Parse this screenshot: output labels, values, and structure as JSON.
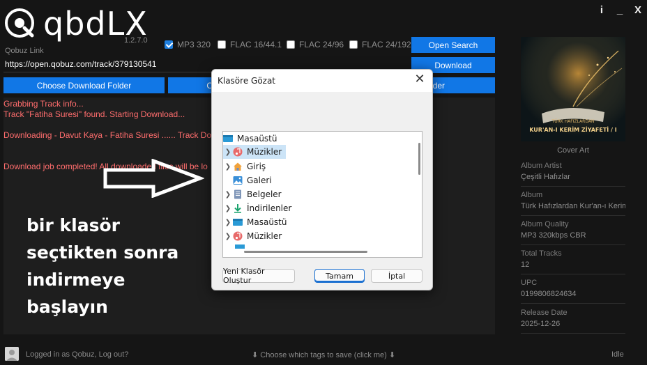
{
  "app": {
    "name": "qbdLX",
    "version": "1.2.7.0",
    "window_controls": [
      "i",
      "_",
      "X"
    ]
  },
  "link": {
    "label": "Qobuz Link",
    "value": "https://open.qobuz.com/track/379130541"
  },
  "formats": [
    {
      "label": "MP3 320",
      "checked": true
    },
    {
      "label": "FLAC 16/44.1",
      "checked": false
    },
    {
      "label": "FLAC 24/96",
      "checked": false
    },
    {
      "label": "FLAC 24/192",
      "checked": false
    }
  ],
  "buttons": {
    "open_search": "Open Search",
    "download": "Download",
    "choose_folder": "Choose Download Folder",
    "open_folder_partial": "O",
    "right_partial": "lder"
  },
  "log": [
    "Grabbing Track info...",
    "Track \"Fatiha Suresi\" found. Starting Download...",
    "Downloading - Davut Kaya - Fatiha Suresi ...... Track Do",
    "Download job completed! All downloaded files will be lo"
  ],
  "overlay": {
    "lines": [
      "bir klasör",
      "seçtikten sonra",
      "indirmeye",
      "başlayın"
    ]
  },
  "cover": {
    "small_text": "TÜRK HAFIZLARDAN",
    "title_text": "KUR'AN-I KERİM ZİYAFETİ / I",
    "caption": "Cover Art"
  },
  "meta": [
    {
      "label": "Album Artist",
      "value": "Çeşitli Hafızlar"
    },
    {
      "label": "Album",
      "value": "Türk Hafızlardan Kur'an-ı Kerim Z"
    },
    {
      "label": "Album Quality",
      "value": "MP3 320kbps CBR"
    },
    {
      "label": "Total Tracks",
      "value": "12"
    },
    {
      "label": "UPC",
      "value": "0199806824634"
    },
    {
      "label": "Release Date",
      "value": "2025-12-26"
    }
  ],
  "status": {
    "login": "Logged in as Qobuz, Log out?",
    "tags": "⬇ Choose which tags to save (click me) ⬇",
    "state": "Idle"
  },
  "dialog": {
    "title": "Klasöre Gözat",
    "close": "✕",
    "tree": [
      {
        "label": "Masaüstü",
        "icon": "desktop-icon",
        "chevron": false,
        "selected": false,
        "root": true
      },
      {
        "label": "Müzikler",
        "icon": "music-icon",
        "chevron": true,
        "selected": true
      },
      {
        "label": "Giriş",
        "icon": "home-icon",
        "chevron": true,
        "selected": false
      },
      {
        "label": "Galeri",
        "icon": "gallery-icon",
        "chevron": false,
        "selected": false
      },
      {
        "label": "Belgeler",
        "icon": "documents-icon",
        "chevron": true,
        "selected": false
      },
      {
        "label": "İndirilenler",
        "icon": "downloads-icon",
        "chevron": true,
        "selected": false
      },
      {
        "label": "Masaüstü",
        "icon": "desktop-icon",
        "chevron": true,
        "selected": false
      },
      {
        "label": "Müzikler",
        "icon": "music-icon",
        "chevron": true,
        "selected": false
      }
    ],
    "new_folder": "Yeni Klasör Oluştur",
    "ok": "Tamam",
    "cancel": "İptal"
  },
  "colors": {
    "accent_blue": "#1177e6",
    "log_text": "#ff6d6d",
    "background": "#151515"
  }
}
